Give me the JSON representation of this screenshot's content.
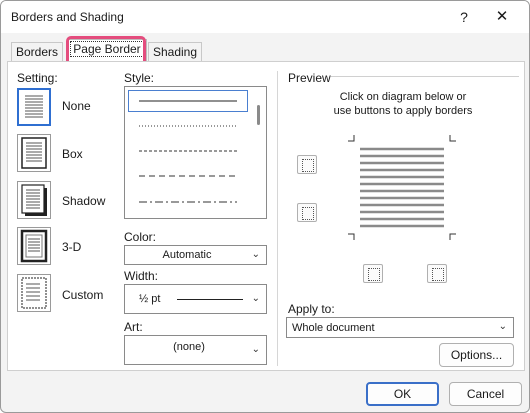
{
  "window": {
    "title": "Borders and Shading",
    "help": "?",
    "close": "✕"
  },
  "tabs": [
    {
      "label": "Borders"
    },
    {
      "label": "Page Border"
    },
    {
      "label": "Shading"
    }
  ],
  "setting": {
    "heading": "Setting:",
    "items": [
      {
        "label": "None"
      },
      {
        "label": "Box"
      },
      {
        "label": "Shadow"
      },
      {
        "label": "3-D"
      },
      {
        "label": "Custom"
      }
    ]
  },
  "style": {
    "heading": "Style:"
  },
  "color": {
    "label": "Color:",
    "value": "Automatic"
  },
  "width": {
    "label": "Width:",
    "value": "½ pt"
  },
  "art": {
    "label": "Art:",
    "value": "(none)"
  },
  "preview": {
    "heading": "Preview",
    "instruction_line1": "Click on diagram below or",
    "instruction_line2": "use buttons to apply borders"
  },
  "apply_to": {
    "label": "Apply to:",
    "value": "Whole document"
  },
  "buttons": {
    "options": "Options...",
    "ok": "OK",
    "cancel": "Cancel"
  }
}
